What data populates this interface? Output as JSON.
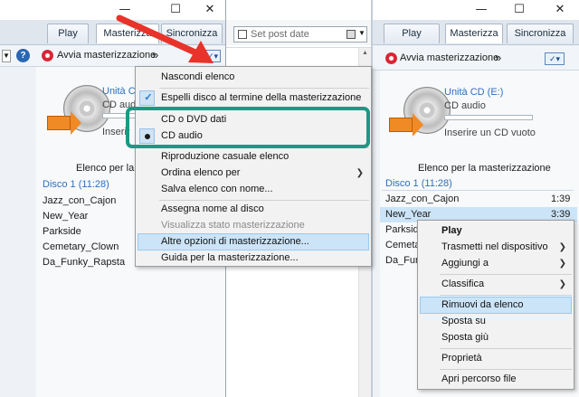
{
  "tabs": {
    "play": "Play",
    "burn": "Masterizza",
    "sync": "Sincronizza"
  },
  "toolbar": {
    "start_burn": "Avvia masterizzazione",
    "more": "»"
  },
  "drive": {
    "name": "Unità CD (E:)",
    "name_short": "Unità CD",
    "type": "CD audio",
    "type_short": "CD audio",
    "insert": "Inserire un CD vuoto",
    "insert_short": "Inserir"
  },
  "burn_list": {
    "title": "Elenco per la masterizzazione",
    "title_short": "Elenco per la ma",
    "disc": "Disco 1 (11:28)"
  },
  "tracks": [
    {
      "title": "Jazz_con_Cajon",
      "duration": "1:39"
    },
    {
      "title": "New_Year",
      "duration": "3:39"
    },
    {
      "title": "Parkside",
      "duration": ""
    },
    {
      "title": "Cemetary_Clown",
      "duration": ""
    },
    {
      "title": "Da_Funky_Rapsta",
      "duration": ""
    }
  ],
  "right_tracks": [
    "Jazz_con_Cajon",
    "New_Year",
    "Parkside",
    "Cemeta",
    "Da_Fun"
  ],
  "search": {
    "placeholder": "Set post date"
  },
  "burn_menu": {
    "items": [
      "Nascondi elenco",
      "Espelli disco al termine della masterizzazione",
      "CD o DVD dati",
      "CD audio",
      "Riproduzione casuale elenco",
      "Ordina elenco per",
      "Salva elenco con nome...",
      "Assegna nome al disco",
      "Visualizza stato masterizzazione",
      "Altre opzioni di masterizzazione...",
      "Guida per la masterizzazione..."
    ]
  },
  "context_menu": {
    "items": [
      "Play",
      "Trasmetti nel dispositivo",
      "Aggiungi a",
      "Classifica",
      "Rimuovi da elenco",
      "Sposta su",
      "Sposta giù",
      "Proprietà",
      "Apri percorso file"
    ]
  },
  "colors": {
    "highlight_box": "#1a9a84",
    "red_arrow": "#e8332a",
    "link_blue": "#2f6fbf",
    "menu_highlight": "#cce4f7"
  }
}
